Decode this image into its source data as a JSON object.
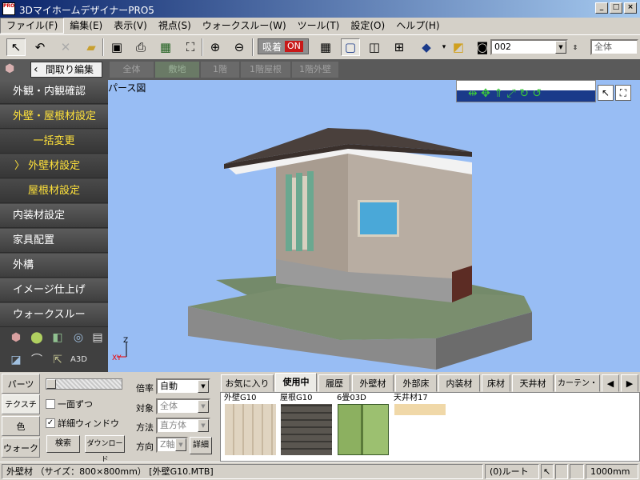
{
  "app": {
    "title": "3DマイホームデザイナーPRO5",
    "icon_text": "PRO"
  },
  "menu": [
    {
      "label": "ファイル(F)"
    },
    {
      "label": "編集(E)"
    },
    {
      "label": "表示(V)"
    },
    {
      "label": "視点(S)"
    },
    {
      "label": "ウォークスルー(W)"
    },
    {
      "label": "ツール(T)"
    },
    {
      "label": "設定(O)"
    },
    {
      "label": "ヘルプ(H)"
    }
  ],
  "toolbar": {
    "adsorb_label": "吸着",
    "adsorb_state": "ON",
    "view_number": "002",
    "scope": "全体"
  },
  "modebar": {
    "back_label": "間取り編集",
    "floor_tabs": [
      "全体",
      "敷地",
      "1階",
      "1階屋根",
      "1階外壁"
    ]
  },
  "leftpanel": {
    "items": [
      {
        "label": "外観・内観確認"
      },
      {
        "label": "外壁・屋根材設定"
      },
      {
        "label": "一括変更"
      },
      {
        "label": "外壁材設定"
      },
      {
        "label": "屋根材設定"
      },
      {
        "label": "内装材設定"
      },
      {
        "label": "家具配置"
      },
      {
        "label": "外構"
      },
      {
        "label": "イメージ仕上げ"
      },
      {
        "label": "ウォークスルー"
      }
    ]
  },
  "viewport": {
    "label": "パース図",
    "axis_z": "Z",
    "axis_xy": "XY"
  },
  "bottom": {
    "vtabs": [
      "パーツ",
      "テクスチャ",
      "色",
      "ウォーク"
    ],
    "chk_ichimen": "一面ずつ",
    "chk_detail": "詳細ウィンドウ",
    "btn_search": "検索",
    "btn_download": "ダウンロード",
    "field_ratio_label": "倍率",
    "field_ratio_value": "自動",
    "field_target_label": "対象",
    "field_target_value": "全体",
    "field_method_label": "方法",
    "field_method_value": "直方体",
    "field_dir_label": "方向",
    "field_dir_value": "Z軸",
    "btn_detail": "詳細",
    "tabs": [
      "お気に入り",
      "使用中",
      "履歴",
      "外壁材",
      "外部床",
      "内装材",
      "床材",
      "天井材",
      "カーテン・布"
    ],
    "materials": [
      {
        "name": "外壁G10"
      },
      {
        "name": "屋根G10"
      },
      {
        "name": "6畳03D"
      },
      {
        "name": "天井材17"
      }
    ]
  },
  "status": {
    "main": "外壁材 （サイズ：800×800mm） [外壁G10.MTB]",
    "route": "(0)ルート",
    "scale": "1000mm"
  }
}
